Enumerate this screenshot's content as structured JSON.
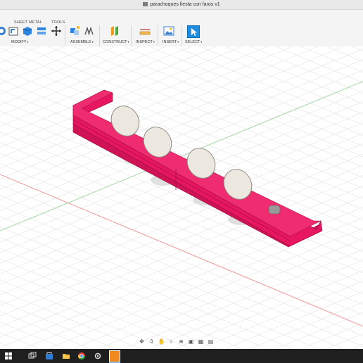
{
  "window": {
    "title": "parachoques fiesta con faros v1"
  },
  "toolbar": {
    "section_labels": {
      "sheet_metal": "SHEET METAL",
      "tools": "TOOLS"
    },
    "groups": [
      {
        "label": "MODIFY"
      },
      {
        "label": "ASSEMBLE"
      },
      {
        "label": "CONSTRUCT"
      },
      {
        "label": "INSPECT"
      },
      {
        "label": "INSERT"
      },
      {
        "label": "SELECT"
      }
    ],
    "caret": "▾"
  },
  "colors": {
    "part_body": "#e6175f",
    "part_edge": "#b00e47",
    "lamp_face": "#ece8e0",
    "lamp_edge": "#8f8b84",
    "grid_line": "#e3e3e3",
    "axis_red": "#ef7a7a",
    "axis_green": "#8fd68f",
    "select_active": "#1d8ee0"
  },
  "nav_icons": [
    "orbit-icon",
    "pan-icon",
    "hand-icon",
    "zoom-icon",
    "zoom-window-icon",
    "display-icon",
    "grid-icon",
    "viewports-icon"
  ],
  "taskbar_icons": [
    "windows-start-icon",
    "search-icon",
    "task-view-icon",
    "store-icon",
    "file-explorer-icon",
    "edge-icon",
    "chrome-icon",
    "settings-icon",
    "fusion-icon"
  ]
}
